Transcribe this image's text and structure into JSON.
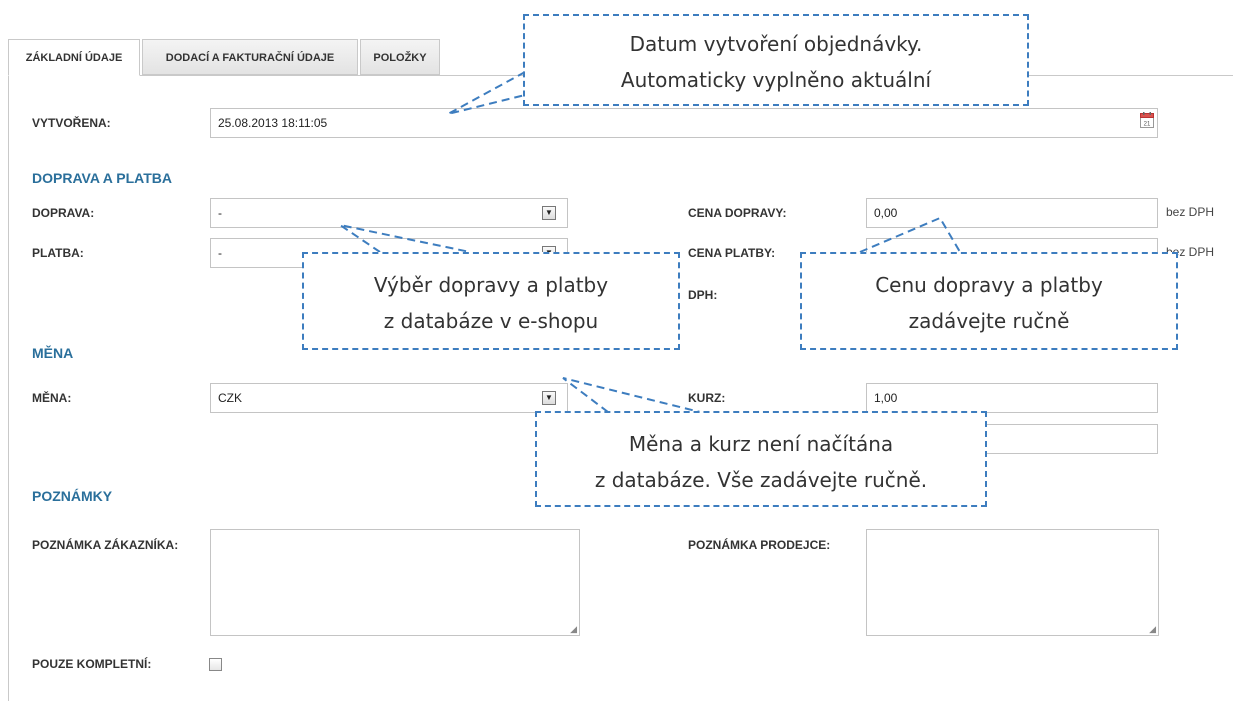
{
  "tabs": [
    {
      "label": "ZÁKLADNÍ ÚDAJE",
      "active": true
    },
    {
      "label": "DODACÍ A FAKTURAČNÍ ÚDAJE",
      "active": false
    },
    {
      "label": "POLOŽKY",
      "active": false
    }
  ],
  "created": {
    "label": "VYTVOŘENA:",
    "value": "25.08.2013 18:11:05",
    "calendar_icon": "calendar-icon",
    "calendar_day": "21"
  },
  "shipping_payment": {
    "title": "DOPRAVA A PLATBA",
    "shipping_label": "DOPRAVA:",
    "shipping_value": "-",
    "payment_label": "PLATBA:",
    "payment_value": "-",
    "shipping_price_label": "CENA DOPRAVY:",
    "shipping_price_value": "0,00",
    "shipping_price_unit": "bez DPH",
    "payment_price_label": "CENA PLATBY:",
    "payment_price_unit": "bez DPH",
    "vat_label": "DPH:"
  },
  "currency": {
    "title": "MĚNA",
    "currency_label": "MĚNA:",
    "currency_value": "CZK",
    "rate_label": "KURZ:",
    "rate_value": "1,00"
  },
  "notes": {
    "title": "POZNÁMKY",
    "customer_label": "POZNÁMKA ZÁKAZNÍKA:",
    "seller_label": "POZNÁMKA PRODEJCE:",
    "complete_only_label": "POUZE KOMPLETNÍ:"
  },
  "callouts": {
    "date": [
      "Datum vytvoření objednávky.",
      "Automaticky vyplněno aktuální"
    ],
    "selection": [
      "Výběr dopravy a platby",
      "z databáze v e-shopu"
    ],
    "price": [
      "Cenu dopravy a platby",
      "zadávejte ručně"
    ],
    "currency": [
      "Měna a kurz není načítána",
      "z databáze. Vše zadávejte ručně."
    ]
  },
  "colors": {
    "accent": "#2a6f9b",
    "callout_border": "#3d7dbf"
  }
}
